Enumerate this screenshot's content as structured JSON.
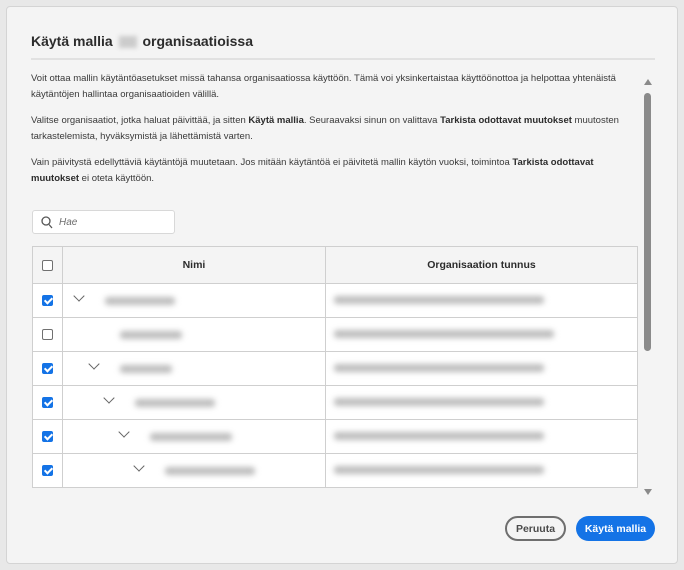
{
  "dialog": {
    "title_before": "Käytä mallia",
    "title_after": "organisaatioissa",
    "paragraphs": {
      "p1": "Voit ottaa mallin käytäntöasetukset missä tahansa organisaatiossa käyttöön. Tämä voi yksinkertaistaa käyttöönottoa ja helpottaa yhtenäistä käytäntöjen hallintaa organisaatioiden välillä.",
      "p2a": "Valitse organisaatiot, jotka haluat päivittää, ja sitten ",
      "p2b": "Käytä mallia",
      "p2c": ". Seuraavaksi sinun on valittava ",
      "p2d": "Tarkista odottavat muutokset",
      "p2e": " muutosten tarkastelemista, hyväksymistä ja lähettämistä varten.",
      "p3a": "Vain päivitystä edellyttäviä käytäntöjä muutetaan. Jos mitään käytäntöä ei päivitetä mallin käytön vuoksi, toimintoa ",
      "p3b": "Tarkista odottavat muutokset",
      "p3c": " ei oteta käyttöön."
    },
    "search": {
      "placeholder": "Hae",
      "value": ""
    },
    "table": {
      "headers": {
        "name": "Nimi",
        "org_id": "Organisaation tunnus"
      },
      "select_all_checked": false,
      "rows": [
        {
          "checked": true,
          "expanded": true,
          "depth": 0
        },
        {
          "checked": false,
          "expanded": false,
          "depth": 1
        },
        {
          "checked": true,
          "expanded": true,
          "depth": 1
        },
        {
          "checked": true,
          "expanded": true,
          "depth": 2
        },
        {
          "checked": true,
          "expanded": true,
          "depth": 3
        },
        {
          "checked": true,
          "expanded": true,
          "depth": 4
        }
      ]
    },
    "buttons": {
      "cancel": "Peruuta",
      "apply": "Käytä mallia"
    },
    "accent_color": "#1473e6"
  }
}
